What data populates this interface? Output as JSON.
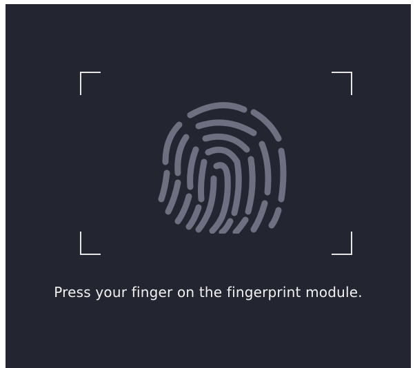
{
  "screen": {
    "background_color": "#232530",
    "frame_color": "#e6e6e6",
    "fingerprint_color": "#6e7081",
    "fingerprint_icon": "fingerprint-icon",
    "prompt_text": "Press your finger on the fingerprint module."
  }
}
